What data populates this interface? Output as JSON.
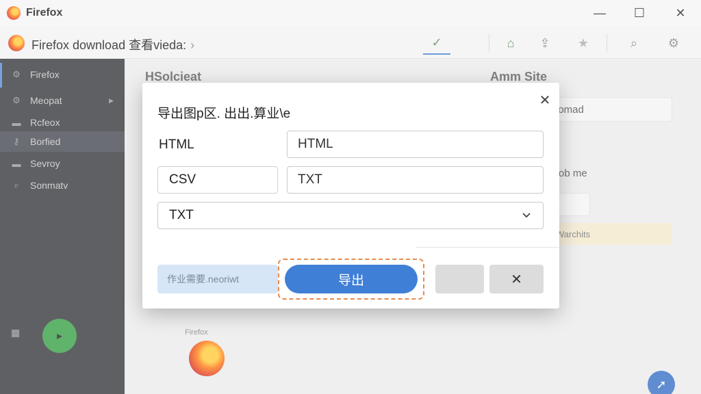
{
  "window": {
    "title": "Firefox",
    "minimize": "—",
    "maximize": "☐",
    "close": "✕"
  },
  "toolbar": {
    "breadcrumb": "Firefox  download  查看vieda:",
    "breadcrumb_chevron": "›",
    "check": "✓",
    "home": "⌂",
    "share": "⇪",
    "star": "★",
    "search": "⌕",
    "settings": "⚙"
  },
  "sidebar": {
    "items": [
      {
        "label": "Firefox",
        "icon": "gear-icon",
        "glyph": "⚙"
      },
      {
        "label": "Meopat",
        "icon": "gear-icon",
        "glyph": "⚙"
      },
      {
        "label": "Rcfeox",
        "icon": "folder-icon",
        "glyph": "▬"
      },
      {
        "label": "Borfied",
        "icon": "key-icon",
        "glyph": "⚷"
      },
      {
        "label": "Sevroy",
        "icon": "folder-icon",
        "glyph": "▬"
      },
      {
        "label": "Sonmatv",
        "icon": "tag-icon",
        "glyph": "⌕"
      }
    ],
    "grid_glyph": "▦"
  },
  "background": {
    "heading_left": "HSolcieat",
    "heading_right": "Amm Site",
    "right_text_1": "iomad",
    "right_text_2": "ob me",
    "note": "Warchits",
    "firefox_label": "Firefox",
    "fab_glyph": "➚"
  },
  "dialog": {
    "title": "导出图p区. 出出.算业\\e",
    "close": "✕",
    "row1": {
      "label": "HTML",
      "value": "HTML"
    },
    "row2": {
      "label": "CSV",
      "value": "TXT"
    },
    "format_select": "TXT",
    "status": "作业需要.neoriwt",
    "export_label": "导出",
    "cancel_label": "✕"
  },
  "colors": {
    "accent": "#3f7fd6",
    "focus_ring": "#e88a4a",
    "sidebar_bg": "#3b3e43"
  }
}
